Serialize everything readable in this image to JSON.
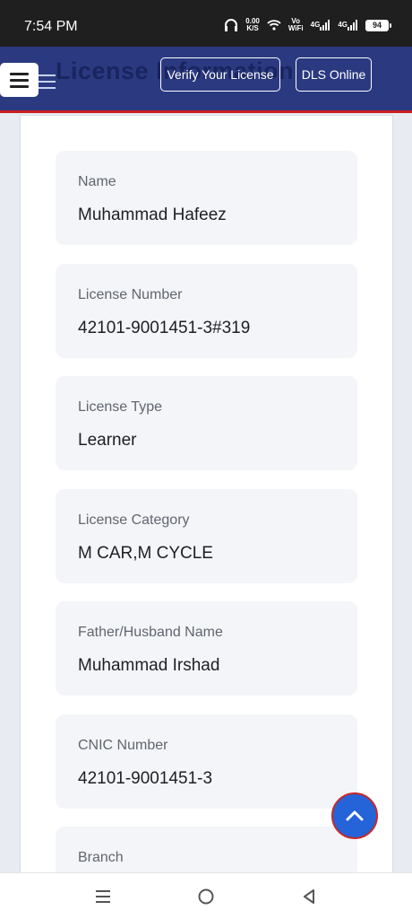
{
  "status_bar": {
    "time": "7:54 PM",
    "speed_top": "0.00",
    "speed_unit": "K/S",
    "vowifi_top": "Vo",
    "vowifi_bottom": "WiFi",
    "net1": "4G",
    "net2": "4G",
    "battery": "94"
  },
  "header": {
    "title": "License Information",
    "verify_label": "Verify Your License",
    "dls_label": "DLS Online",
    "background_color": "#2b3a80",
    "accent_border_color": "#c81e1e"
  },
  "fields": [
    {
      "label": "Name",
      "value": "Muhammad Hafeez"
    },
    {
      "label": "License Number",
      "value": "42101-9001451-3#319"
    },
    {
      "label": "License Type",
      "value": "Learner"
    },
    {
      "label": "License Category",
      "value": "M CAR,M CYCLE"
    },
    {
      "label": "Father/Husband Name",
      "value": "Muhammad Irshad"
    },
    {
      "label": "CNIC Number",
      "value": "42101-9001451-3"
    },
    {
      "label": "Branch",
      "value": ""
    }
  ],
  "scroll_top_button": {
    "icon": "chevron-up-icon",
    "color": "#2563d8"
  },
  "nav_bar": {
    "recents_icon": "recents-icon",
    "home_icon": "home-icon",
    "back_icon": "back-icon"
  }
}
